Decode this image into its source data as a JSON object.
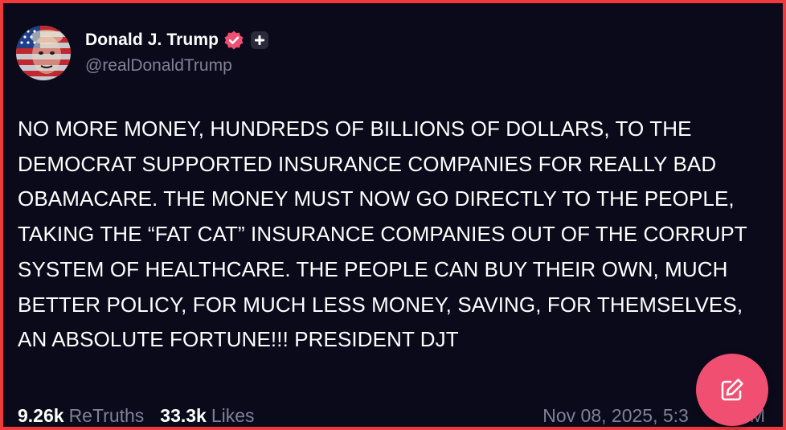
{
  "author": {
    "display_name": "Donald J. Trump",
    "handle": "@realDonaldTrump",
    "avatar_icon": "flag-portrait-avatar",
    "verified_icon": "verified-badge-icon",
    "plus_icon": "plus-badge-icon"
  },
  "post": {
    "text": "NO MORE MONEY, HUNDREDS OF BILLIONS OF DOLLARS, TO THE DEMOCRAT SUPPORTED INSURANCE COMPANIES FOR REALLY BAD OBAMACARE. THE MONEY MUST NOW GO DIRECTLY TO THE PEOPLE, TAKING THE “FAT CAT” INSURANCE COMPANIES OUT OF THE CORRUPT SYSTEM OF HEALTHCARE. THE PEOPLE CAN BUY THEIR OWN, MUCH BETTER POLICY, FOR MUCH LESS MONEY, SAVING, FOR THEMSELVES, AN ABSOLUTE FORTUNE!!! PRESIDENT DJT"
  },
  "stats": {
    "retruths_count": "9.26k",
    "retruths_label": "ReTruths",
    "likes_count": "33.3k",
    "likes_label": "Likes"
  },
  "timestamp": "Nov 08, 2025, 5:3",
  "timestamp_tail": "M",
  "compose_button": {
    "icon": "compose-pencil-icon"
  },
  "colors": {
    "background": "#0b0a1a",
    "border": "#ee3a3d",
    "muted_text": "#808097",
    "fab": "#f04f72",
    "verified": "#f04f72"
  }
}
